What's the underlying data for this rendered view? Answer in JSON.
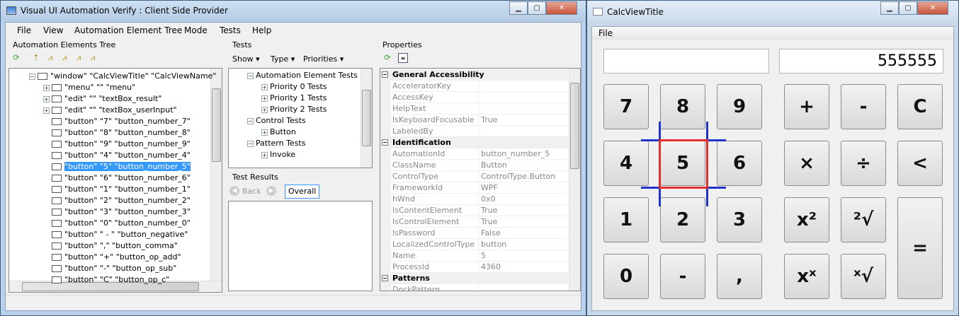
{
  "uia": {
    "title": "Visual UI Automation Verify : Client Side Provider",
    "menu": [
      "File",
      "View",
      "Automation Element Tree",
      "Mode",
      "Tests",
      "Help"
    ],
    "tree_title": "Automation Elements Tree",
    "tree": [
      {
        "text": "\"window\" \"CalcViewTitle\" \"CalcViewName\"",
        "expander": "⊟"
      },
      {
        "text": "\"menu\" \"\" \"menu\"",
        "expander": "⊞"
      },
      {
        "text": "\"edit\" \"\" \"textBox_result\"",
        "expander": "⊞"
      },
      {
        "text": "\"edit\" \"\" \"textBox_userInput\"",
        "expander": "⊞"
      },
      {
        "text": "\"button\" \"7\" \"button_number_7\""
      },
      {
        "text": "\"button\" \"8\" \"button_number_8\""
      },
      {
        "text": "\"button\" \"9\" \"button_number_9\""
      },
      {
        "text": "\"button\" \"4\" \"button_number_4\""
      },
      {
        "text": "\"button\" \"5\" \"button_number_5\"",
        "selected": true
      },
      {
        "text": "\"button\" \"6\" \"button_number_6\""
      },
      {
        "text": "\"button\" \"1\" \"button_number_1\""
      },
      {
        "text": "\"button\" \"2\" \"button_number_2\""
      },
      {
        "text": "\"button\" \"3\" \"button_number_3\""
      },
      {
        "text": "\"button\" \"0\" \"button_number_0\""
      },
      {
        "text": "\"button\" \" - \" \"button_negative\""
      },
      {
        "text": "\"button\" \",\" \"button_comma\""
      },
      {
        "text": "\"button\" \"+\" \"button_op_add\""
      },
      {
        "text": "\"button\" \"-\" \"button_op_sub\""
      },
      {
        "text": "\"button\" \"C\" \"button_op_c\""
      }
    ],
    "tests_title": "Tests",
    "tests_toolbar": {
      "show": "Show",
      "type": "Type",
      "priorities": "Priorities"
    },
    "tests_tree": [
      {
        "text": "Automation Element Tests",
        "expander": "⊟",
        "level": 0
      },
      {
        "text": "Priority 0 Tests",
        "expander": "⊞",
        "level": 1
      },
      {
        "text": "Priority 1 Tests",
        "expander": "⊞",
        "level": 1
      },
      {
        "text": "Priority 2 Tests",
        "expander": "⊞",
        "level": 1
      },
      {
        "text": "Control Tests",
        "expander": "⊟",
        "level": 0
      },
      {
        "text": "Button",
        "expander": "⊞",
        "level": 1
      },
      {
        "text": "Pattern Tests",
        "expander": "⊟",
        "level": 0
      },
      {
        "text": "Invoke",
        "expander": "⊞",
        "level": 1
      }
    ],
    "results_title": "Test Results",
    "back_label": "Back",
    "overall_label": "Overall",
    "props_title": "Properties",
    "properties": [
      {
        "cat": "General Accessibility"
      },
      {
        "k": "AcceleratorKey",
        "v": ""
      },
      {
        "k": "AccessKey",
        "v": ""
      },
      {
        "k": "HelpText",
        "v": ""
      },
      {
        "k": "IsKeyboardFocusable",
        "v": "True"
      },
      {
        "k": "LabeledBy",
        "v": ""
      },
      {
        "cat": "Identification"
      },
      {
        "k": "AutomationId",
        "v": "button_number_5"
      },
      {
        "k": "ClassName",
        "v": "Button"
      },
      {
        "k": "ControlType",
        "v": "ControlType.Button"
      },
      {
        "k": "FrameworkId",
        "v": "WPF"
      },
      {
        "k": "hWnd",
        "v": "0x0"
      },
      {
        "k": "IsContentElement",
        "v": "True"
      },
      {
        "k": "IsControlElement",
        "v": "True"
      },
      {
        "k": "IsPassword",
        "v": "False"
      },
      {
        "k": "LocalizedControlType",
        "v": "button"
      },
      {
        "k": "Name",
        "v": "5"
      },
      {
        "k": "ProcessId",
        "v": "4360"
      },
      {
        "cat": "Patterns"
      },
      {
        "k": "DockPattern",
        "v": ""
      }
    ]
  },
  "calc": {
    "title": "CalcViewTitle",
    "menu_file": "File",
    "display_input": "",
    "display_result": "555555",
    "buttons": [
      "7",
      "8",
      "9",
      "+",
      "-",
      "C",
      "4",
      "5",
      "6",
      "×",
      "÷",
      "<",
      "1",
      "2",
      "3",
      "x²",
      "²√",
      "0",
      "-",
      ",",
      "xˣ",
      "ˣ√",
      "="
    ]
  },
  "highlight_color": "#e03030",
  "crosshair_color": "#2233cc"
}
